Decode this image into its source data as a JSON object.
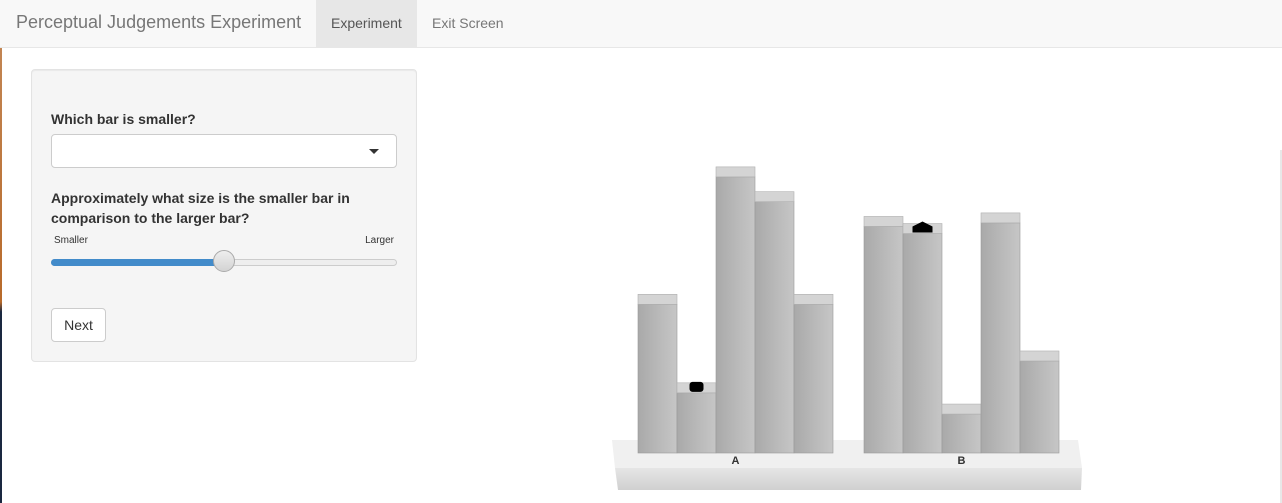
{
  "navbar": {
    "brand": "Perceptual Judgements Experiment",
    "tabs": [
      {
        "label": "Experiment",
        "active": true
      },
      {
        "label": "Exit Screen",
        "active": false
      }
    ]
  },
  "form": {
    "question1": "Which bar is smaller?",
    "select_value": "",
    "question2": "Approximately what size is the smaller bar in comparison to the larger bar?",
    "slider": {
      "min_label": "Smaller",
      "max_label": "Larger",
      "value_fraction": 0.5
    },
    "next_label": "Next"
  },
  "chart_data": {
    "type": "bar",
    "style": "3d",
    "groups": [
      {
        "label": "A",
        "values": [
          42,
          17,
          78,
          71,
          42
        ],
        "marked_index": 1
      },
      {
        "label": "B",
        "values": [
          64,
          62,
          11,
          65,
          26
        ],
        "marked_index": 1
      }
    ],
    "marker_color": "#000000",
    "bar_color": "#b0b0b0"
  },
  "colors": {
    "accent": "#428bca",
    "navbar_bg": "#f8f8f8",
    "well_bg": "#f5f5f5"
  }
}
